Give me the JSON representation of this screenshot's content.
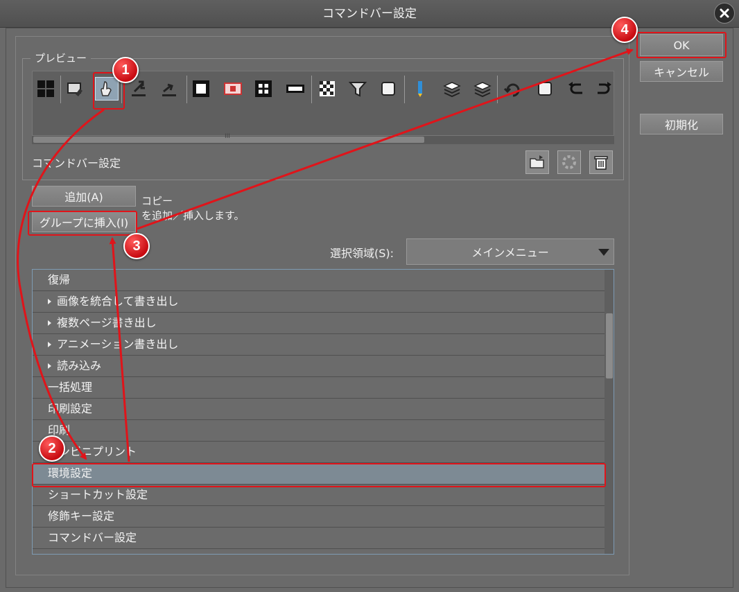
{
  "window": {
    "title": "コマンドバー設定"
  },
  "preview": {
    "group_label": "プレビュー",
    "icons": [
      "grid-icon",
      "edit-image-icon",
      "hand-tool-icon",
      "export-icon",
      "import-icon",
      "frame-icon",
      "red-image-icon",
      "crop-icon",
      "film-icon",
      "checker-icon",
      "funnel-icon",
      "square-icon",
      "pencil-icon",
      "layers-icon",
      "layers-alt-icon",
      "rotate-icon",
      "white-square-icon",
      "undo-icon",
      "redo-icon"
    ],
    "scroll_grip": "III"
  },
  "commandbar": {
    "label": "コマンドバー設定",
    "buttons": [
      "open-folder-icon",
      "loading-icon",
      "trash-icon"
    ]
  },
  "actions": {
    "add_label": "追加(A)",
    "insert_group_label": "グループに挿入(I)",
    "desc_line1": "コピー",
    "desc_line2": "を追加／挿入します。"
  },
  "selection": {
    "label": "選択領域(S):",
    "value": "メインメニュー"
  },
  "list": {
    "items": [
      {
        "label": "復帰",
        "expand": false
      },
      {
        "label": "画像を統合して書き出し",
        "expand": true
      },
      {
        "label": "複数ページ書き出し",
        "expand": true
      },
      {
        "label": "アニメーション書き出し",
        "expand": true
      },
      {
        "label": "読み込み",
        "expand": true
      },
      {
        "label": "一括処理",
        "expand": false
      },
      {
        "label": "印刷設定",
        "expand": false
      },
      {
        "label": "印刷",
        "expand": false
      },
      {
        "label": "コンビニプリント",
        "expand": false
      },
      {
        "label": "環境設定",
        "expand": false,
        "selected": true
      },
      {
        "label": "ショートカット設定",
        "expand": false
      },
      {
        "label": "修飾キー設定",
        "expand": false
      },
      {
        "label": "コマンドバー設定",
        "expand": false
      }
    ]
  },
  "side_buttons": {
    "ok": "OK",
    "cancel": "キャンセル",
    "reset": "初期化"
  },
  "annotations": {
    "badges": [
      "1",
      "2",
      "3",
      "4"
    ],
    "color": "#e0141a"
  }
}
